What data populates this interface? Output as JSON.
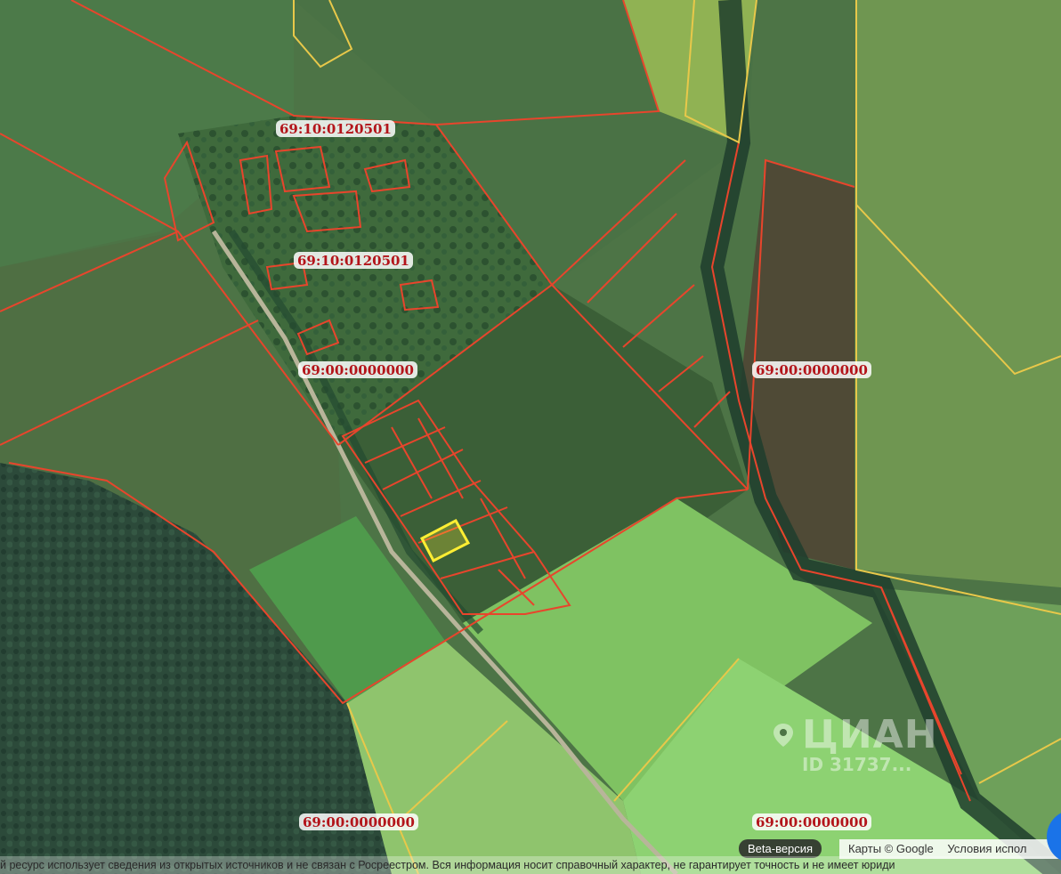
{
  "map": {
    "cadastral_labels": [
      {
        "id": "lbl1",
        "text": "69:10:0120501"
      },
      {
        "id": "lbl2",
        "text": "69:10:0120501"
      },
      {
        "id": "lbl3",
        "text": "69:00:0000000"
      },
      {
        "id": "lbl4",
        "text": "69:00:0000000"
      },
      {
        "id": "lbl5",
        "text": "69:00:0000000"
      },
      {
        "id": "lbl6",
        "text": "69:00:0000000"
      }
    ],
    "colors": {
      "parcel_border": "#e8452c",
      "quarter_border": "#e8c84a",
      "selected_parcel": "#ffee33",
      "label_text": "#b3141a"
    }
  },
  "watermark": {
    "brand": "ЦИАН",
    "id_text": "ID 31737..."
  },
  "footer": {
    "beta_label": "Beta-версия",
    "attribution_maps": "Карты © Google",
    "attribution_terms": "Условия испол",
    "disclaimer": "й ресурс использует сведения из открытых источников и не связан с Росреестром. Вся информация носит справочный характер, не гарантирует точность и не имеет юриди"
  }
}
